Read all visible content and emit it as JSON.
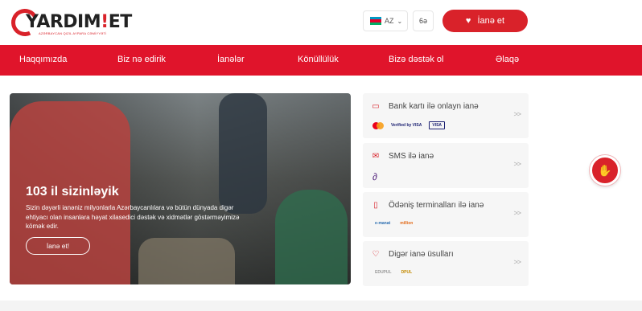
{
  "header": {
    "logo_text_main": "YARDIM",
    "logo_text_bang": "!",
    "logo_text_end": "ET",
    "logo_subtitle": "AZƏRBAYCAN QIZIL AYPARA CƏMİYYƏTİ",
    "language": "AZ",
    "contrast_label": "6ə",
    "donate_label": "İanə et"
  },
  "nav": {
    "items": [
      {
        "label": "Haqqımızda"
      },
      {
        "label": "Biz nə edirik"
      },
      {
        "label": "İanələr"
      },
      {
        "label": "Könüllülük"
      },
      {
        "label": "Bizə dəstək ol"
      },
      {
        "label": "Əlaqə"
      }
    ]
  },
  "hero": {
    "title": "103 il sizinləyik",
    "text": "Sizin dəyərli ianəniz milyonlarla Azərbaycanlılara və bütün dünyada digər ehtiyacı olan insanlara həyat xilasedici dəstək və xidmətlər göstərməyimizə kömək edir.",
    "button_label": "İanə et!"
  },
  "methods": [
    {
      "label": "Bank kartı ilə onlayn ianə",
      "icon": "card-icon",
      "logos": [
        "mastercard",
        "Verified by VISA",
        "VISA"
      ]
    },
    {
      "label": "SMS ilə ianə",
      "icon": "sms-icon",
      "logos": [
        "azercell"
      ]
    },
    {
      "label": "Ödəniş terminalları ilə ianə",
      "icon": "terminal-icon",
      "logos": [
        "e-manat",
        "million"
      ]
    },
    {
      "label": "Digər ianə üsulları",
      "icon": "hand-heart-icon",
      "logos": [
        "EDUPUL",
        "DPUL"
      ]
    }
  ],
  "colors": {
    "brand_red": "#e0142b",
    "button_red": "#d9222a"
  }
}
